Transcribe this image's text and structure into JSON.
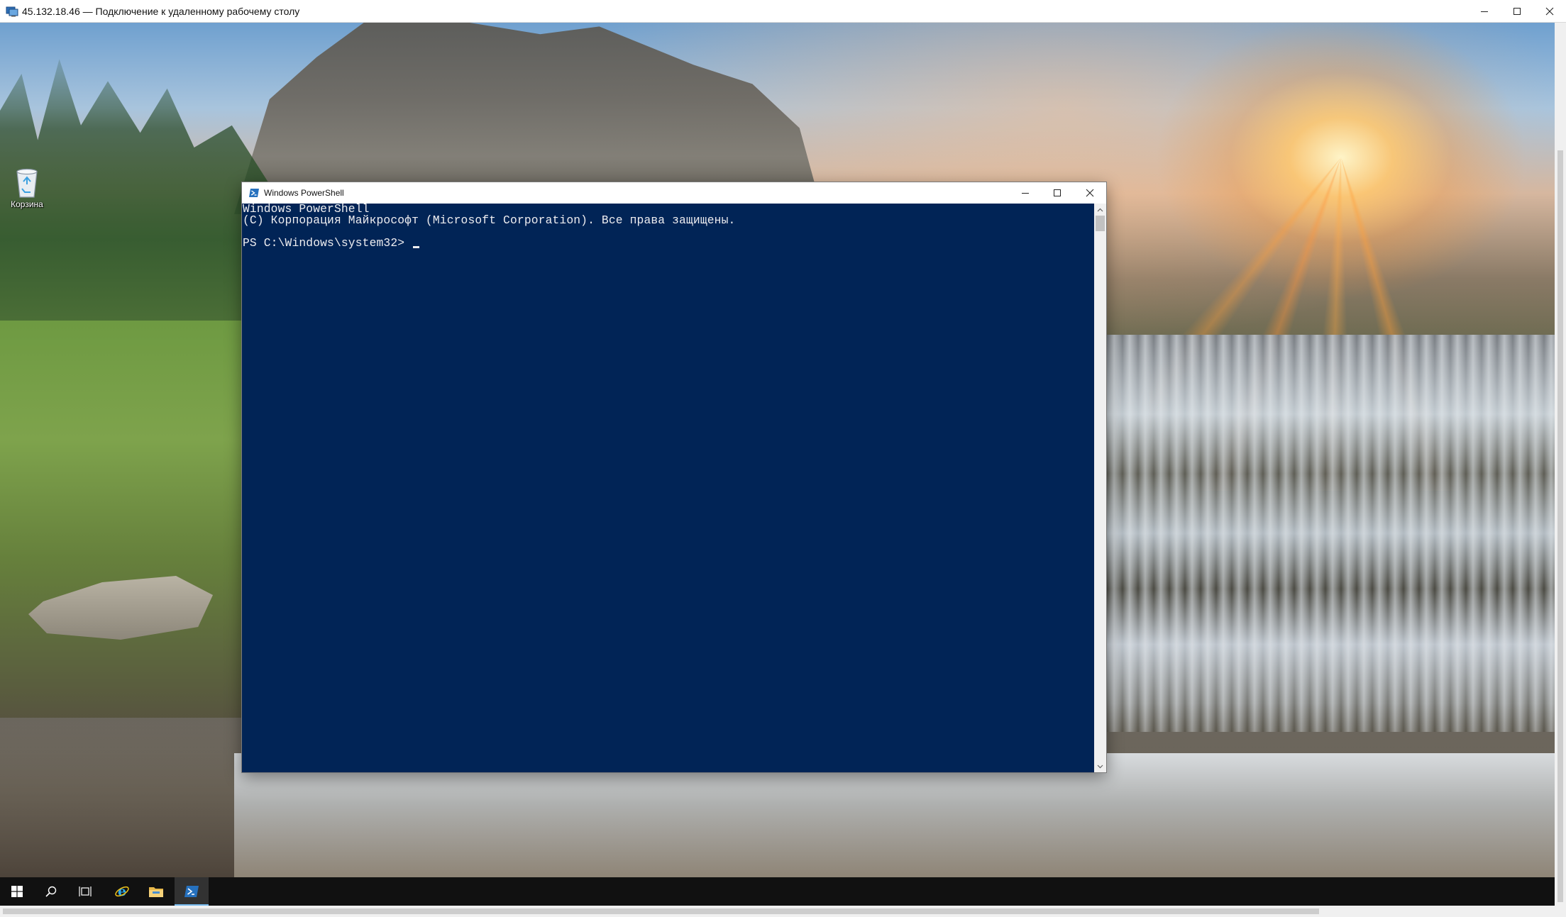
{
  "rdp_window": {
    "title": "45.132.18.46 — Подключение к удаленному рабочему столу",
    "icon": "remote-desktop-icon",
    "controls": [
      "minimize",
      "maximize",
      "close"
    ]
  },
  "desktop": {
    "icons": [
      {
        "label": "Корзина",
        "icon": "recycle-bin-icon"
      }
    ]
  },
  "powershell": {
    "title": "Windows PowerShell",
    "icon": "powershell-icon",
    "lines": [
      "Windows PowerShell",
      "(C) Корпорация Майкрософт (Microsoft Corporation). Все права защищены.",
      "",
      "PS C:\\Windows\\system32> "
    ],
    "colors": {
      "console_bg": "#012456",
      "text": "#eeedf0"
    }
  },
  "taskbar": {
    "items": [
      {
        "name": "start",
        "icon": "windows-start-icon"
      },
      {
        "name": "search",
        "icon": "search-icon"
      },
      {
        "name": "task-view",
        "icon": "task-view-icon"
      },
      {
        "name": "internet-explorer",
        "icon": "internet-explorer-icon"
      },
      {
        "name": "file-explorer",
        "icon": "folder-icon"
      },
      {
        "name": "powershell",
        "icon": "powershell-icon",
        "active": true
      }
    ],
    "colors": {
      "active_underline": "#76b9ed"
    }
  }
}
